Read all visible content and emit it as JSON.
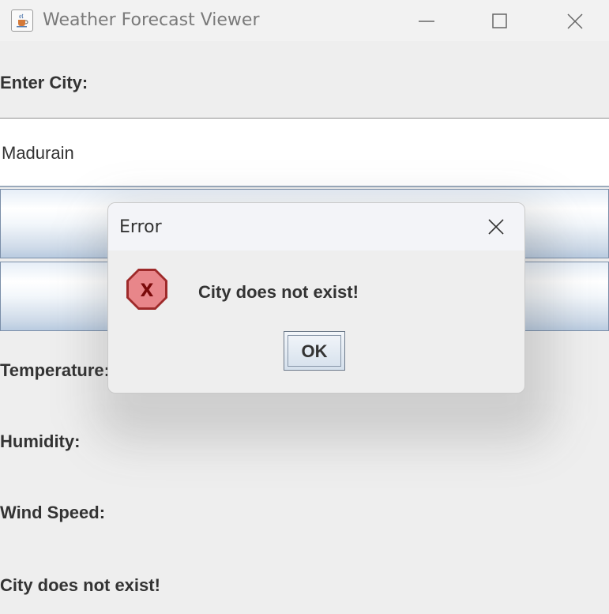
{
  "window": {
    "title": "Weather Forecast Viewer",
    "icons": [
      "java-cup-icon",
      "minimize-icon",
      "maximize-icon",
      "close-icon"
    ]
  },
  "form": {
    "city_label": "Enter City:",
    "city_value": "Madurain",
    "temperature_label": "Temperature:",
    "humidity_label": "Humidity:",
    "wind_label": "Wind Speed:",
    "status_text": "City does not exist!"
  },
  "dialog": {
    "title": "Error",
    "message": "City does not exist!",
    "icon_letter": "X",
    "ok_label": "OK"
  },
  "colors": {
    "error_icon_fill": "#e8868a",
    "error_icon_letter": "#7a0a0a",
    "button_gradient_top": "#ffffff",
    "button_gradient_bottom": "#b9cbe0"
  }
}
